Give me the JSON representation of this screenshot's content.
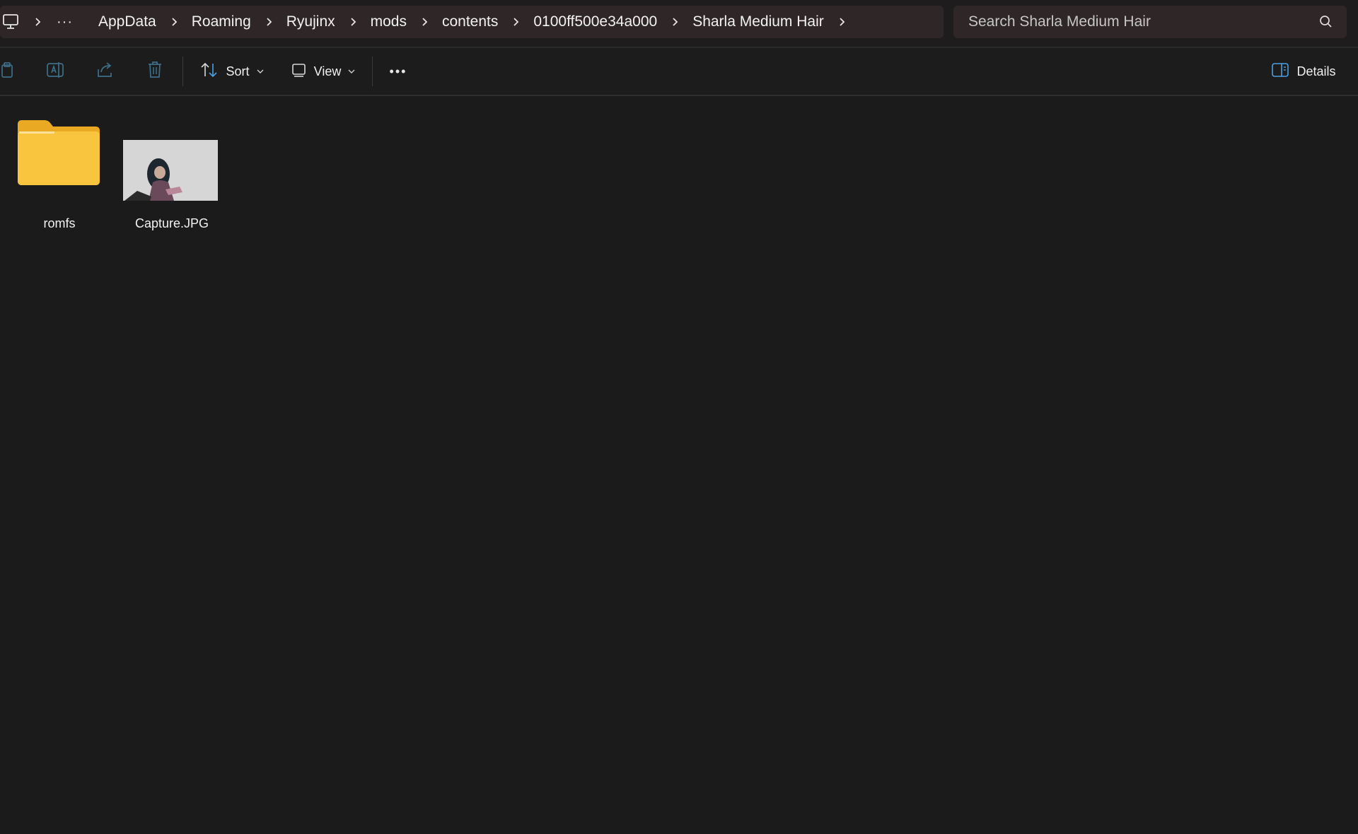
{
  "breadcrumb": {
    "overflow_label": "···",
    "items": [
      {
        "label": "AppData"
      },
      {
        "label": "Roaming"
      },
      {
        "label": "Ryujinx"
      },
      {
        "label": "mods"
      },
      {
        "label": "contents"
      },
      {
        "label": "0100ff500e34a000"
      },
      {
        "label": "Sharla Medium Hair"
      }
    ]
  },
  "search": {
    "placeholder": "Search Sharla Medium Hair"
  },
  "toolbar": {
    "icons": [
      "paste-icon",
      "rename-icon",
      "share-icon",
      "delete-icon"
    ],
    "sort_label": "Sort",
    "view_label": "View",
    "more_label": "•••",
    "details_label": "Details"
  },
  "files": [
    {
      "name": "romfs",
      "type": "folder",
      "icon": "folder-icon"
    },
    {
      "name": "Capture.JPG",
      "type": "image",
      "icon": "image-thumbnail"
    }
  ],
  "colors": {
    "background": "#1b1b1b",
    "address_bar": "#2f2627",
    "folder": "#f9c53f",
    "accent": "#4ca0e0"
  }
}
